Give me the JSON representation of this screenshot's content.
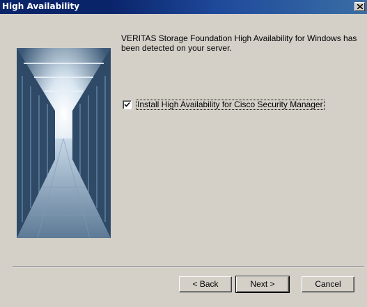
{
  "window": {
    "title": "High Availability",
    "close_label": "×"
  },
  "message": "VERITAS Storage Foundation High Availability for Windows has been detected on your server.",
  "checkbox": {
    "label": "Install High Availability for Cisco Security Manager",
    "checked": true
  },
  "buttons": {
    "back": "< Back",
    "next": "Next >",
    "cancel": "Cancel"
  },
  "colors": {
    "titlebar": "#0a246a",
    "face": "#d4d0c8"
  },
  "icons": {
    "close": "close-icon",
    "check": "check-icon",
    "image": "server-room-image"
  }
}
